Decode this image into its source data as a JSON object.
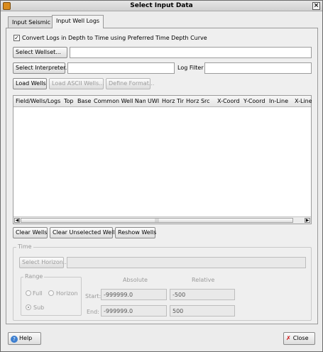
{
  "window": {
    "title": "Select Input Data"
  },
  "tabs": [
    {
      "label": "Input Seismic",
      "active": false
    },
    {
      "label": "Input Well Logs",
      "active": true
    }
  ],
  "convert": {
    "label": "Convert Logs in Depth to Time using Preferred Time Depth Curve",
    "checked": true
  },
  "wellset": {
    "button": "Select Wellset...",
    "value": ""
  },
  "interpreter": {
    "button": "Select Interpreter...",
    "value": ""
  },
  "log_filter": {
    "label": "Log Filter",
    "value": ""
  },
  "load_buttons": {
    "load_wells": "Load Wells",
    "load_ascii": "Load ASCII Wells...",
    "define_format": "Define Format..."
  },
  "table": {
    "columns": [
      "Field/Wells/Logs",
      "Top",
      "Base",
      "Common Well Nam",
      "UWI",
      "Horz Tin",
      "Horz Src",
      "X-Coord",
      "Y-Coord",
      "In-Line",
      "X-Line"
    ],
    "rows": [],
    "scroll_grip": "|||"
  },
  "well_buttons": {
    "clear": "Clear Wells",
    "clear_unselected": "Clear Unselected Wells",
    "reshow": "Reshow Wells"
  },
  "time": {
    "legend": "Time",
    "select_horizon": "Select Horizon...",
    "horizon_value": "",
    "range_legend": "Range",
    "options": {
      "full": "Full",
      "horizon": "Horizon",
      "sub": "Sub"
    },
    "selected": "sub",
    "absolute_label": "Absolute",
    "relative_label": "Relative",
    "start_label": "Start:",
    "end_label": "End:",
    "start_absolute": "-999999.0",
    "start_relative": "-500",
    "end_absolute": "-999999.0",
    "end_relative": "500"
  },
  "footer": {
    "help": "Help",
    "close": "Close"
  },
  "icons": {
    "app": "app-icon",
    "close_window": "close-icon",
    "help": "help-icon",
    "close_button": "close-x-icon",
    "scroll_left": "arrow-left-icon",
    "scroll_right": "arrow-right-icon"
  }
}
